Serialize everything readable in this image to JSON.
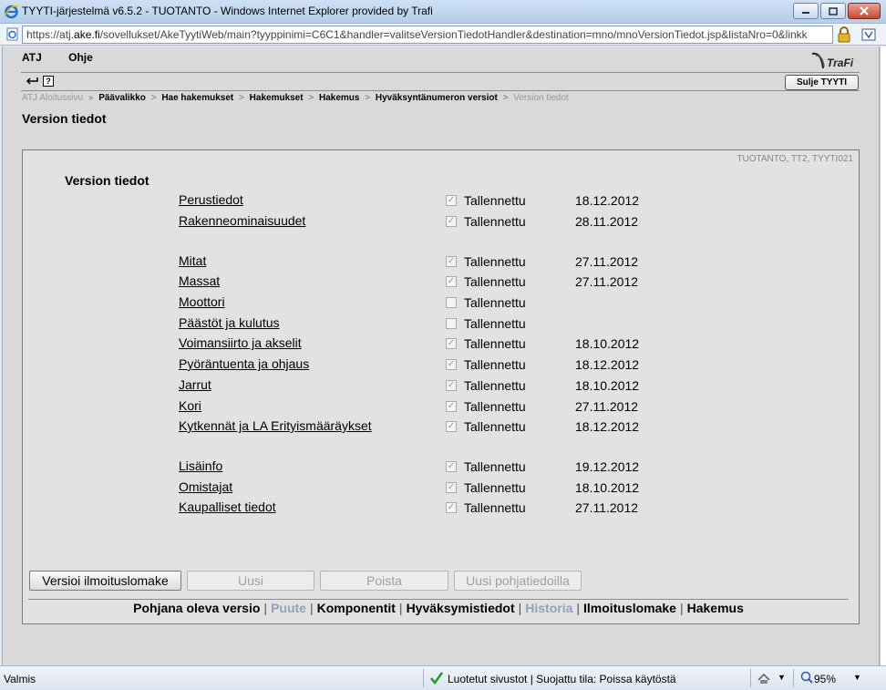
{
  "window": {
    "title": "TYYTI-järjestelmä v6.5.2 - TUOTANTO - Windows Internet Explorer provided by Trafi",
    "url_host": "https://atj.",
    "url_domain": "ake.fi",
    "url_rest": "/sovellukset/AkeTyytiWeb/main?tyyppinimi=C6C1&handler=valitseVersionTiedotHandler&destination=mno/mnoVersionTiedot.jsp&listaNro=0&linkk"
  },
  "menu": {
    "item1": "ATJ",
    "item2": "Ohje"
  },
  "toolbar": {
    "close_label": "Sulje TYYTI"
  },
  "breadcrumb": {
    "home": "ATJ Aloitussivu",
    "home_sep": "»",
    "items": [
      "Päävalikko",
      "Hae hakemukset",
      "Hakemukset",
      "Hakemus",
      "Hyväksyntänumeron versiot"
    ],
    "sep": ">",
    "current": "Version tiedot"
  },
  "page_title": "Version tiedot",
  "environment": "TUOTANTO, TT2, TYYTI021",
  "section_title": "Version tiedot",
  "status_label": "Tallennettu",
  "rows": [
    {
      "label": "Perustiedot",
      "checked": true,
      "date": "18.12.2012"
    },
    {
      "label": "Rakenneominaisuudet",
      "checked": true,
      "date": "28.11.2012"
    },
    {
      "label": "Mitat",
      "checked": true,
      "date": "27.11.2012"
    },
    {
      "label": "Massat",
      "checked": true,
      "date": "27.11.2012"
    },
    {
      "label": "Moottori",
      "checked": false,
      "date": ""
    },
    {
      "label": "Päästöt ja kulutus",
      "checked": false,
      "date": ""
    },
    {
      "label": "Voimansiirto ja akselit",
      "checked": true,
      "date": "18.10.2012"
    },
    {
      "label": "Pyöräntuenta ja ohjaus",
      "checked": true,
      "date": "18.12.2012"
    },
    {
      "label": "Jarrut",
      "checked": true,
      "date": "18.10.2012"
    },
    {
      "label": "Kori",
      "checked": true,
      "date": "27.11.2012"
    },
    {
      "label": "Kytkennät ja LA Erityismääräykset",
      "checked": true,
      "date": "18.12.2012"
    },
    {
      "label": "Lisäinfo",
      "checked": true,
      "date": "19.12.2012"
    },
    {
      "label": "Omistajat",
      "checked": true,
      "date": "18.10.2012"
    },
    {
      "label": "Kaupalliset tiedot",
      "checked": true,
      "date": "27.11.2012"
    }
  ],
  "buttons": {
    "versioi": "Versioi ilmoituslomake",
    "uusi": "Uusi",
    "poista": "Poista",
    "uusi_pohja": "Uusi pohjatiedoilla"
  },
  "footer_links": {
    "pohjana": "Pohjana oleva versio",
    "puute": "Puute",
    "komponentit": "Komponentit",
    "hyvaksymistiedot": "Hyväksymistiedot",
    "historia": "Historia",
    "ilmoituslomake": "Ilmoituslomake",
    "hakemus": "Hakemus",
    "pipe": "|"
  },
  "statusbar": {
    "left": "Valmis",
    "zone": "Luotetut sivustot | Suojattu tila: Poissa käytöstä",
    "zoom": "95%"
  },
  "colors": {
    "page_bg": "#d9d9d9",
    "panel_bg": "#e2e2e2",
    "muted_link": "#8ea2bb"
  }
}
